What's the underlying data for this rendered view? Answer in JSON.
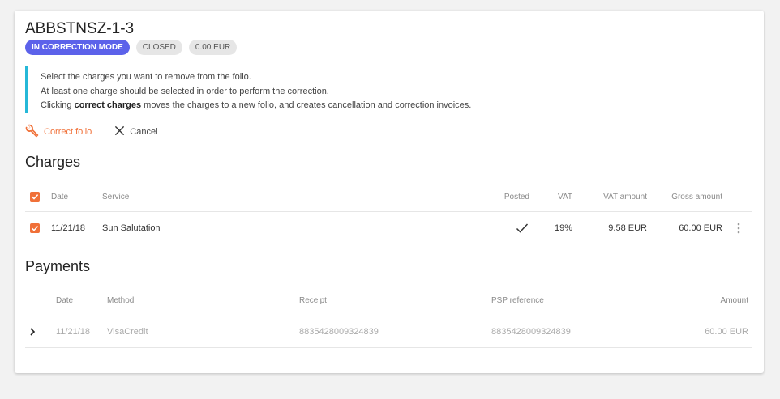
{
  "folio": {
    "title": "ABBSTNSZ-1-3",
    "badges": [
      "IN CORRECTION MODE",
      "CLOSED",
      "0.00 EUR"
    ]
  },
  "info": {
    "line1": "Select the charges you want to remove from the folio.",
    "line2": "At least one charge should be selected in order to perform the correction.",
    "line3_prefix": "Clicking ",
    "line3_bold": "correct charges",
    "line3_suffix": " moves the charges to a new folio, and creates cancellation and correction invoices."
  },
  "actions": {
    "correct_label": "Correct folio",
    "cancel_label": "Cancel"
  },
  "charges": {
    "title": "Charges",
    "headers": {
      "date": "Date",
      "service": "Service",
      "posted": "Posted",
      "vat": "VAT",
      "vat_amount": "VAT amount",
      "gross_amount": "Gross amount"
    },
    "rows": [
      {
        "date": "11/21/18",
        "service": "Sun Salutation",
        "vat": "19%",
        "vat_amount": "9.58 EUR",
        "gross_amount": "60.00 EUR"
      }
    ]
  },
  "payments": {
    "title": "Payments",
    "headers": {
      "date": "Date",
      "method": "Method",
      "receipt": "Receipt",
      "psp_reference": "PSP reference",
      "amount": "Amount"
    },
    "rows": [
      {
        "date": "11/21/18",
        "method": "VisaCredit",
        "receipt": "8835428009324839",
        "psp_reference": "8835428009324839",
        "amount": "60.00 EUR"
      }
    ]
  },
  "colors": {
    "accent": "#5c62ea",
    "orange": "#f07038",
    "info_border": "#26b8d8"
  }
}
